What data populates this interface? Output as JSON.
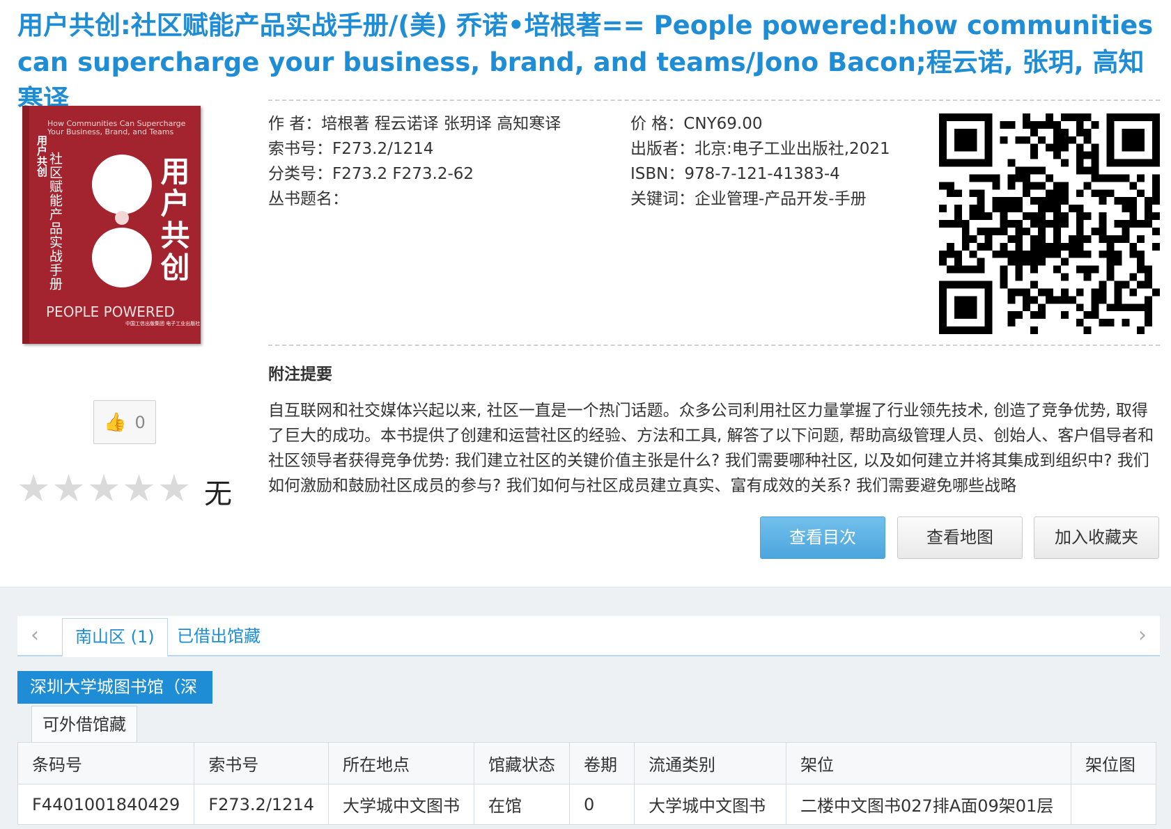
{
  "title": "用户共创:社区赋能产品实战手册/(美) 乔诺•培根著== People powered:how communities can supercharge your business, brand, and teams/Jono Bacon;程云诺, 张玥, 高知寒译",
  "cover": {
    "en_top": "How Communities Can Supercharge Your Business, Brand, and Teams",
    "side_title": "用户共创",
    "subtitle": "社区赋能产品实战手册",
    "big_title": "用户共创",
    "people_powered": "PEOPLE POWERED",
    "publisher": "中国工信出版集团  电子工业出版社"
  },
  "like": {
    "icon": "thumbs-up-icon",
    "count": "0"
  },
  "rating": {
    "stars_filled": 0,
    "stars_total": 5,
    "label": "无"
  },
  "meta_left": {
    "author": "作 者：培根著  程云诺译  张玥译  高知寒译",
    "call_no": "索书号：F273.2/1214",
    "class_no": "分类号：F273.2   F273.2-62",
    "series": "丛书题名："
  },
  "meta_right": {
    "price": "价 格：CNY69.00",
    "publisher": "出版者：北京:电子工业出版社,2021",
    "isbn": "ISBN：978-7-121-41383-4",
    "keywords": "关键词：企业管理-产品开发-手册"
  },
  "note": {
    "heading": "附注提要",
    "text": "自互联网和社交媒体兴起以来, 社区一直是一个热门话题。众多公司利用社区力量掌握了行业领先技术, 创造了竞争优势, 取得了巨大的成功。本书提供了创建和运营社区的经验、方法和工具, 解答了以下问题, 帮助高级管理人员、创始人、客户倡导者和社区领导者获得竞争优势: 我们建立社区的关键价值主张是什么? 我们需要哪种社区, 以及如何建立并将其集成到组织中? 我们如何激励和鼓励社区成员的参与? 我们如何与社区成员建立真实、富有成效的关系? 我们需要避免哪些战略"
  },
  "buttons": {
    "toc": "查看目次",
    "map": "查看地图",
    "fav": "加入收藏夹"
  },
  "tabs": {
    "active": "南山区 (1)",
    "other": "已借出馆藏"
  },
  "library": "深圳大学城图书馆（深",
  "subtab": "可外借馆藏",
  "table": {
    "headers": [
      "条码号",
      "索书号",
      "所在地点",
      "馆藏状态",
      "卷期",
      "流通类别",
      "架位",
      "架位图"
    ],
    "rows": [
      [
        "F4401001840429",
        "F273.2/1214",
        "大学城中文图书",
        "在馆",
        "0",
        "大学城中文图书",
        "二楼中文图书027排A面09架01层",
        ""
      ]
    ]
  }
}
